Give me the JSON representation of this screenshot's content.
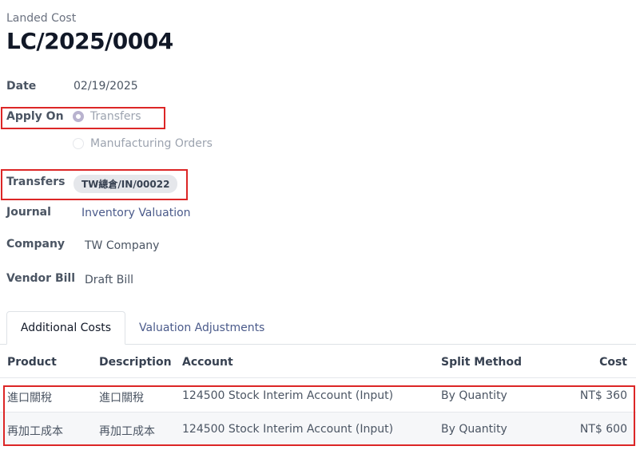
{
  "form": {
    "caption": "Landed Cost",
    "title": "LC/2025/0004"
  },
  "fields": {
    "date_label": "Date",
    "date_value": "02/19/2025",
    "apply_on_label": "Apply On",
    "apply_on_options": [
      "Transfers",
      "Manufacturing Orders"
    ],
    "apply_on_selected": "Transfers",
    "transfers_label": "Transfers",
    "transfers_tag": "TW總倉/IN/00022",
    "journal_label": "Journal",
    "journal_value": "Inventory Valuation",
    "company_label": "Company",
    "company_value": "TW Company",
    "vendor_bill_label": "Vendor Bill",
    "vendor_bill_value": "Draft Bill"
  },
  "tabs": {
    "items": [
      "Additional Costs",
      "Valuation Adjustments"
    ],
    "active": "Additional Costs"
  },
  "table": {
    "headers": [
      "Product",
      "Description",
      "Account",
      "Split Method",
      "Cost"
    ],
    "rows": [
      {
        "product": "進口關稅",
        "description": "進口關稅",
        "account": "124500 Stock Interim Account (Input)",
        "split_method": "By Quantity",
        "cost": "NT$ 360"
      },
      {
        "product": "再加工成本",
        "description": "再加工成本",
        "account": "124500 Stock Interim Account (Input)",
        "split_method": "By Quantity",
        "cost": "NT$ 600"
      }
    ]
  },
  "colors": {
    "highlight_box": "#dc2626",
    "link": "#4a5a8a",
    "radio_selected": "#b9b3cf"
  }
}
